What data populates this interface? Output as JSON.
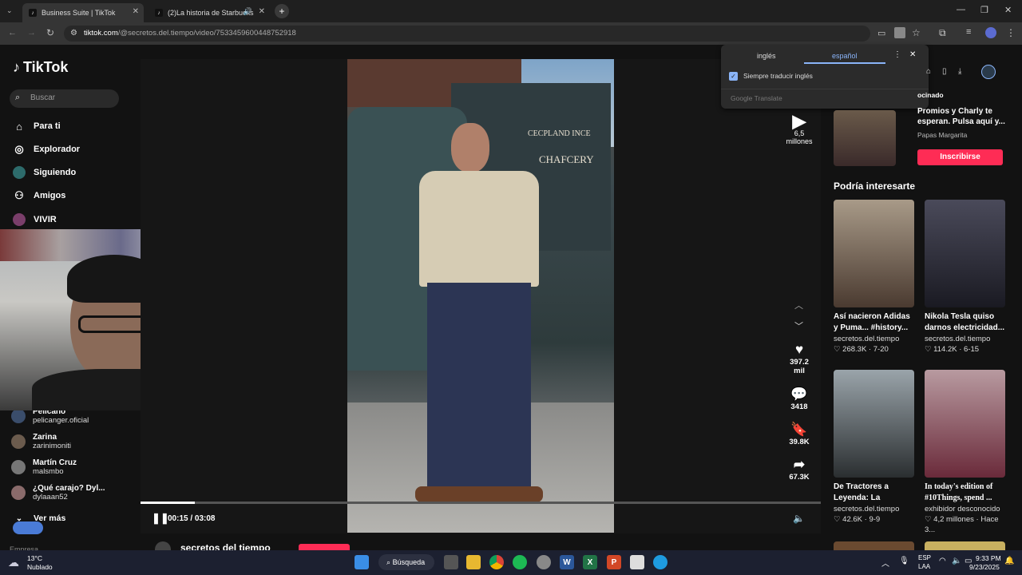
{
  "browser": {
    "tabs": [
      {
        "label": "Business Suite | TikTok"
      },
      {
        "label": "(2)La historia de Starbucks"
      }
    ],
    "url_host": "tiktok.com",
    "url_path": "/@secretos.del.tiempo/video/7533459600448752918"
  },
  "translate": {
    "lang_a": "inglés",
    "lang_b": "español",
    "checkbox_label": "Siempre traducir inglés",
    "footer": "Google Translate"
  },
  "sidebar": {
    "logo": "TikTok",
    "search_placeholder": "Buscar",
    "nav": [
      {
        "label": "Para ti"
      },
      {
        "label": "Explorador"
      },
      {
        "label": "Siguiendo"
      },
      {
        "label": "Amigos"
      },
      {
        "label": "VIVIR"
      }
    ],
    "following": [
      {
        "name": "Pelicano",
        "handle": "pelicanger.oficial"
      },
      {
        "name": "Zarina",
        "handle": "zarinimoniti"
      },
      {
        "name": "Martín Cruz",
        "handle": "malsmbo"
      },
      {
        "name": "¿Qué carajo? Dyl...",
        "handle": "dylaaan52"
      }
    ],
    "see_more": "Ver más",
    "footer_partial": "Empresa"
  },
  "video": {
    "truck_text_line1": "CECPLAND INCE",
    "truck_text_line2": "CHAFCERY",
    "time": "00:15 / 03:08",
    "progress": 0.08,
    "author_partial": "secretos del tiempo"
  },
  "actions": {
    "views": "6,5",
    "views_unit": "millones",
    "likes_a": "397.2",
    "likes_b": "mil",
    "comments": "3418",
    "saves": "39.8K",
    "shares": "67.3K"
  },
  "promo": {
    "label": "ocinado",
    "title": "Promios y Charly te esperan. Pulsa aquí y...",
    "author": "Papas Margarita",
    "button": "Inscribirse"
  },
  "recommend": {
    "heading": "Podría interesarte",
    "cards": [
      {
        "title": "Así nacieron Adidas y Puma... #history...",
        "author": "secretos.del.tiempo",
        "likes": "268.3K",
        "date": "7-20"
      },
      {
        "title": "Nikola Tesla quiso darnos electricidad...",
        "author": "secretos.del.tiempo",
        "likes": "114.2K",
        "date": "6-15"
      },
      {
        "title": "De Tractores a Leyenda: La Histori...",
        "author": "secretos.del.tiempo",
        "likes": "42.6K",
        "date": "9-9"
      },
      {
        "title": "In today's edition of #10Things, spend ...",
        "author": "exhibidor desconocido",
        "likes": "4,2 millones",
        "date": "Hace 3..."
      }
    ]
  },
  "taskbar": {
    "temp": "13°C",
    "weather": "Nublado",
    "search": "Búsqueda",
    "lang_a": "ESP",
    "lang_b": "LAA",
    "time": "9:33 PM",
    "date": "9/23/2025"
  },
  "colors": {
    "accent": "#fe2c55",
    "active_tab": "#1a73e8"
  }
}
